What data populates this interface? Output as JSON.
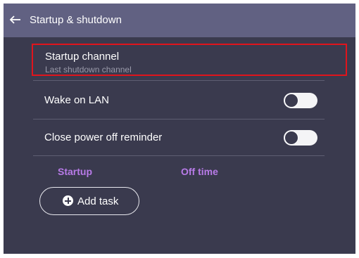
{
  "header": {
    "title": "Startup & shutdown",
    "back_icon": "arrow-left-icon"
  },
  "startup_channel": {
    "label": "Startup channel",
    "value": "Last shutdown channel"
  },
  "wake_on_lan": {
    "label": "Wake on LAN",
    "enabled": false
  },
  "close_power_off_reminder": {
    "label": "Close power off reminder",
    "enabled": false
  },
  "schedule": {
    "columns": [
      "Startup",
      "Off time"
    ],
    "add_task_label": "Add task",
    "add_icon": "plus-circle-icon"
  },
  "colors": {
    "background": "#3a3a4e",
    "header": "#616182",
    "accent": "#b87be8",
    "focus_border": "#e0141c"
  }
}
